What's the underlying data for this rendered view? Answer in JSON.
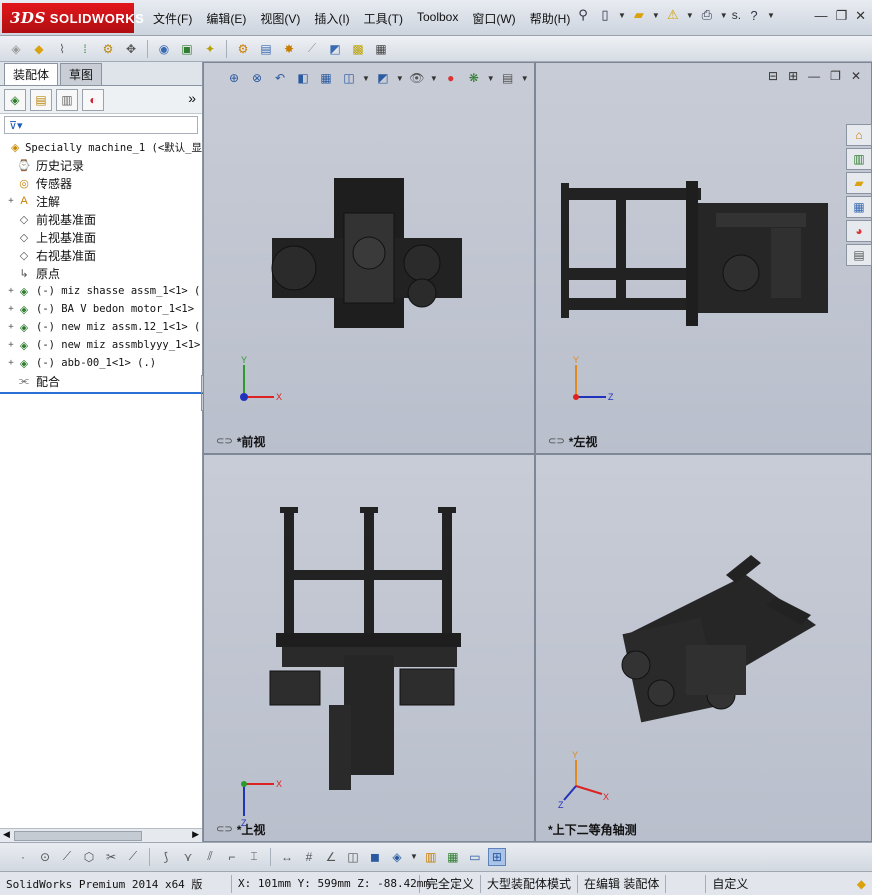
{
  "app": {
    "logo_prefix": "3DS",
    "logo_text": "SOLIDWORKS"
  },
  "menu": [
    "文件(F)",
    "编辑(E)",
    "视图(V)",
    "插入(I)",
    "工具(T)",
    "Toolbox",
    "窗口(W)",
    "帮助(H)"
  ],
  "title_search": "s.",
  "panel": {
    "tabs": [
      "装配体",
      "草图"
    ],
    "tree": [
      {
        "label": "Specially machine_1  (<默认_显",
        "icon": "assembly-icon",
        "expand": "",
        "mono": true,
        "indent": 0
      },
      {
        "label": "历史记录",
        "icon": "history-icon",
        "expand": "",
        "mono": false,
        "indent": 1
      },
      {
        "label": "传感器",
        "icon": "sensor-icon",
        "expand": "",
        "mono": false,
        "indent": 1
      },
      {
        "label": "注解",
        "icon": "annotation-icon",
        "expand": "+",
        "mono": false,
        "indent": 1
      },
      {
        "label": "前视基准面",
        "icon": "plane-icon",
        "expand": "",
        "mono": false,
        "indent": 1
      },
      {
        "label": "上视基准面",
        "icon": "plane-icon",
        "expand": "",
        "mono": false,
        "indent": 1
      },
      {
        "label": "右视基准面",
        "icon": "plane-icon",
        "expand": "",
        "mono": false,
        "indent": 1
      },
      {
        "label": "原点",
        "icon": "origin-icon",
        "expand": "",
        "mono": false,
        "indent": 1
      },
      {
        "label": "(-) miz shasse assm_1<1> (",
        "icon": "subassembly-icon",
        "expand": "+",
        "mono": true,
        "indent": 1
      },
      {
        "label": "(-) BA V bedon motor_1<1>",
        "icon": "subassembly-icon",
        "expand": "+",
        "mono": true,
        "indent": 1
      },
      {
        "label": "(-) new miz assm.12_1<1> (",
        "icon": "subassembly-icon",
        "expand": "+",
        "mono": true,
        "indent": 1
      },
      {
        "label": "(-) new miz assmblyyy_1<1>",
        "icon": "subassembly-icon",
        "expand": "+",
        "mono": true,
        "indent": 1
      },
      {
        "label": "(-) abb-00_1<1> (.)",
        "icon": "subassembly-icon",
        "expand": "+",
        "mono": true,
        "indent": 1
      },
      {
        "label": "配合",
        "icon": "mates-icon",
        "expand": "",
        "mono": false,
        "indent": 1
      }
    ]
  },
  "views": {
    "front": "*前视",
    "left": "*左视",
    "top": "*上视",
    "iso": "*上下二等角轴测"
  },
  "triad": {
    "x": "X",
    "y": "Y",
    "z": "Z"
  },
  "status": {
    "version": "SolidWorks Premium 2014 x64 版",
    "coords": "X: 101mm Y: 599mm Z: -88.42mm",
    "state": "完全定义",
    "mode": "大型装配体模式",
    "editing": "在编辑 装配体",
    "custom": "自定义"
  },
  "colors": {
    "accent": "#2a6fd6",
    "logo_red": "#c8121a",
    "viewport_bg": "#c3c8d2",
    "model": "#1e1e1e"
  }
}
